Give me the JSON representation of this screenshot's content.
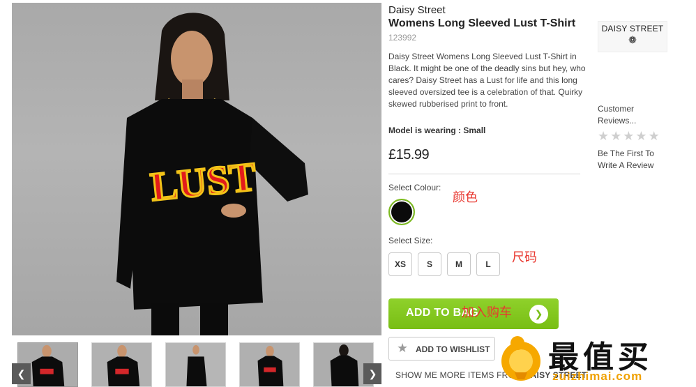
{
  "product": {
    "brand": "Daisy Street",
    "title": "Womens Long Sleeved Lust T-Shirt",
    "sku": "123992",
    "description": "Daisy Street Womens Long Sleeved Lust T-Shirt in Black. It might be one of the deadly sins but hey, who cares? Daisy Street has a Lust for life and this long sleeved oversized tee is a celebration of that. Quirky skewed rubberised print to front.",
    "model_label": "Model is wearing : Small",
    "price": "£15.99",
    "shirt_print": "LUST"
  },
  "options": {
    "colour_label": "Select Colour:",
    "colour_annotation": "颜色",
    "size_label": "Select Size:",
    "size_annotation": "尺码",
    "sizes": [
      "XS",
      "S",
      "M",
      "L"
    ],
    "swatch_color": "#0b0b0b"
  },
  "actions": {
    "add_to_bag": "ADD TO BAG",
    "add_to_bag_annotation": "加入购车",
    "add_to_wishlist": "ADD TO WISHLIST",
    "show_more": "SHOW ME MORE ITEMS FROM",
    "show_more_brand": "DAISY STREET"
  },
  "sidebar": {
    "brand_logo_text": "DAISY STREET",
    "reviews_title": "Customer Reviews...",
    "rating_stars": 0,
    "first_review": "Be The First To Write A Review"
  },
  "gallery": {
    "prev_icon": "chevron-left-icon",
    "next_icon": "chevron-right-icon",
    "thumb_count": 5
  },
  "watermark": {
    "text": "最值买",
    "url": "zuizhimai.com"
  },
  "colors": {
    "accent_green": "#78be14",
    "annotation_red": "#e8372f",
    "watermark_orange": "#f0a100"
  }
}
